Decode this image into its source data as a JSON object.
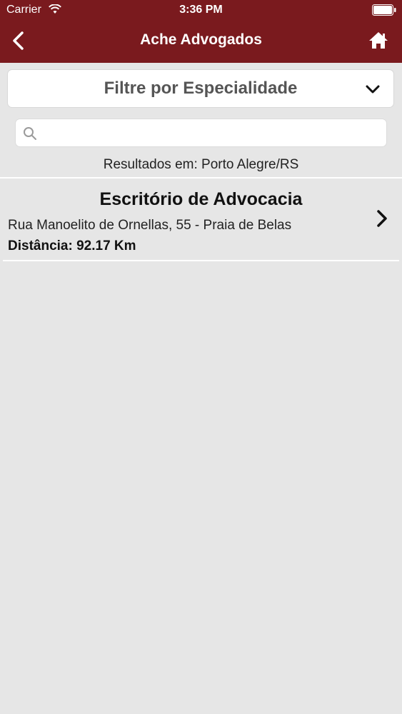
{
  "statusbar": {
    "carrier": "Carrier",
    "time": "3:36 PM",
    "wifi_icon": "wifi-icon",
    "battery_icon": "battery-icon"
  },
  "navbar": {
    "title": "Ache Advogados",
    "back_icon": "chevron-left-icon",
    "home_icon": "home-icon",
    "background_color": "#7a1a1e"
  },
  "filter": {
    "label": "Filtre por Especialidade",
    "icon": "chevron-down-icon"
  },
  "search": {
    "value": "",
    "placeholder": "",
    "icon": "search-icon"
  },
  "results": {
    "summary": "Resultados em: Porto Alegre/RS",
    "items": [
      {
        "title": "Escritório de Advocacia",
        "address": "Rua Manoelito de Ornellas, 55 - Praia de Belas",
        "distance": "Distância: 92.17 Km",
        "icon": "chevron-right-icon"
      }
    ]
  }
}
